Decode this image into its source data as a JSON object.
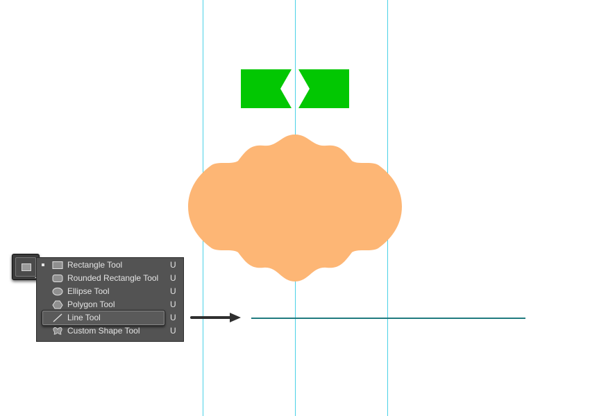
{
  "colors": {
    "guide": "#49d1e6",
    "green": "#02c702",
    "peach": "#fdb675",
    "line": "#1f7a7e",
    "menu_bg": "#535353"
  },
  "tool_button": {
    "icon": "rectangle-tool-icon"
  },
  "menu": {
    "items": [
      {
        "label": "Rectangle Tool",
        "shortcut": "U",
        "icon": "rectangle-icon",
        "selected": true
      },
      {
        "label": "Rounded Rectangle Tool",
        "shortcut": "U",
        "icon": "rounded-rectangle-icon"
      },
      {
        "label": "Ellipse Tool",
        "shortcut": "U",
        "icon": "ellipse-icon"
      },
      {
        "label": "Polygon Tool",
        "shortcut": "U",
        "icon": "polygon-icon"
      },
      {
        "label": "Line Tool",
        "shortcut": "U",
        "icon": "line-icon",
        "highlighted": true
      },
      {
        "label": "Custom Shape Tool",
        "shortcut": "U",
        "icon": "custom-shape-icon"
      }
    ]
  }
}
